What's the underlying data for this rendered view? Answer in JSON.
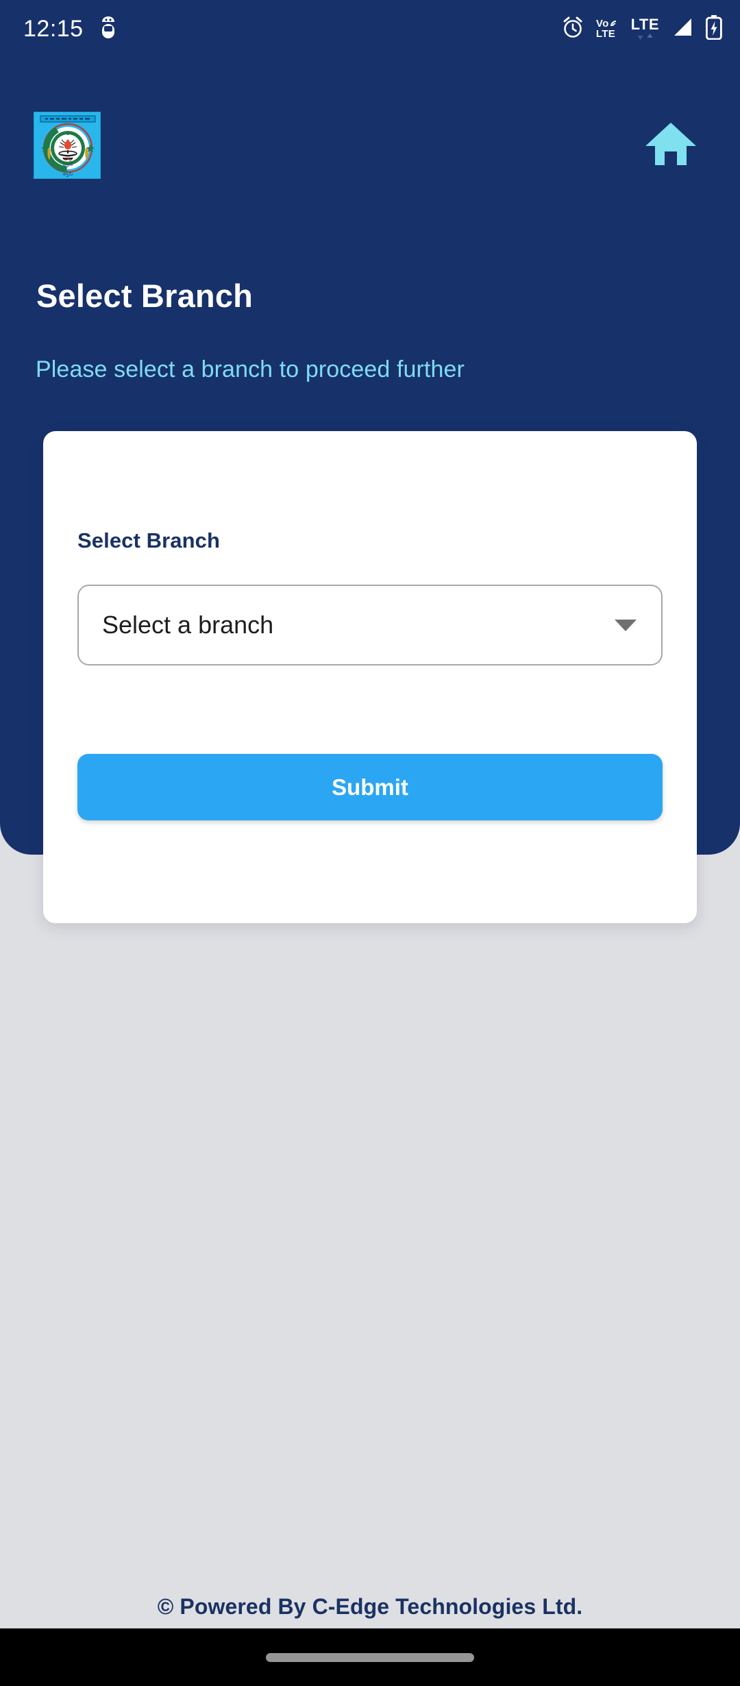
{
  "status_bar": {
    "time": "12:15",
    "icons": [
      {
        "name": "android-debug-icon",
        "label": "debug"
      },
      {
        "name": "alarm-icon",
        "label": "alarm"
      },
      {
        "name": "volte-icon",
        "label": "VoLTE"
      },
      {
        "name": "lte-icon",
        "label": "LTE"
      },
      {
        "name": "signal-icon",
        "label": "signal"
      },
      {
        "name": "battery-charging-icon",
        "label": "battery"
      }
    ],
    "volte_top": "Vo",
    "volte_bottom": "LTE",
    "lte_text": "LTE"
  },
  "header": {
    "logo_name": "bank-logo",
    "home_icon_name": "home-icon",
    "title": "Select Branch",
    "subtitle": "Please select a branch to proceed further"
  },
  "card": {
    "field_label": "Select Branch",
    "dropdown": {
      "selected": "Select a branch",
      "placeholder": "Select a branch"
    },
    "submit_label": "Submit"
  },
  "footer": {
    "text": "© Powered By C-Edge Technologies Ltd."
  },
  "colors": {
    "navy": "#17316b",
    "accent_blue": "#2ba6f2",
    "subtitle_cyan": "#7fdcf2",
    "page_background": "#dedfe3",
    "card_background": "#ffffff",
    "logo_background": "#29b6ec",
    "navbar": "#000000"
  }
}
